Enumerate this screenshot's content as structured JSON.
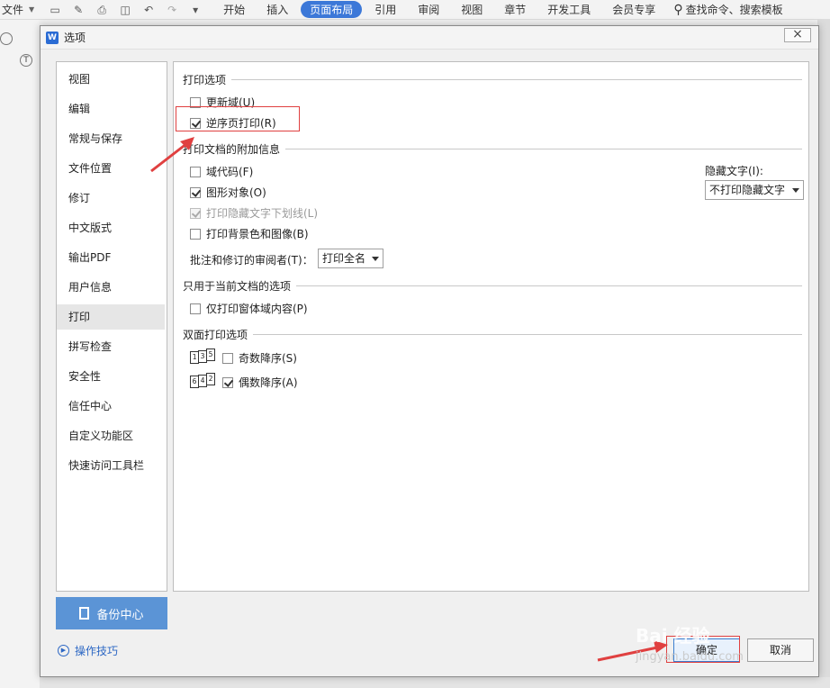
{
  "ribbon": {
    "file_label": "文件",
    "tabs": [
      "开始",
      "插入",
      "页面布局",
      "引用",
      "审阅",
      "视图",
      "章节",
      "开发工具",
      "会员专享"
    ],
    "active_tab": "页面布局",
    "search_text": "查找命令、搜索模板"
  },
  "dialog": {
    "title": "选项",
    "close_label": "×",
    "nav_items": [
      "视图",
      "编辑",
      "常规与保存",
      "文件位置",
      "修订",
      "中文版式",
      "输出PDF",
      "用户信息",
      "打印",
      "拼写检查",
      "安全性",
      "信任中心",
      "自定义功能区",
      "快速访问工具栏"
    ],
    "selected_nav": "打印",
    "backup_label": "备份中心",
    "tips_label": "操作技巧",
    "ok_label": "确定",
    "cancel_label": "取消"
  },
  "print_options": {
    "group_title": "打印选项",
    "update_fields": {
      "label": "更新域(U)",
      "checked": false
    },
    "reverse_print": {
      "label": "逆序页打印(R)",
      "checked": true
    }
  },
  "extra_info": {
    "group_title": "打印文档的附加信息",
    "field_codes": {
      "label": "域代码(F)",
      "checked": false
    },
    "graphics": {
      "label": "图形对象(O)",
      "checked": true
    },
    "hidden_underline": {
      "label": "打印隐藏文字下划线(L)",
      "checked": true,
      "disabled": true
    },
    "background": {
      "label": "打印背景色和图像(B)",
      "checked": false
    },
    "reviewer_label": "批注和修订的审阅者(T)：",
    "reviewer_value": "打印全名",
    "hidden_text_label": "隐藏文字(I):",
    "hidden_text_value": "不打印隐藏文字"
  },
  "current_doc": {
    "group_title": "只用于当前文档的选项",
    "form_only": {
      "label": "仅打印窗体域内容(P)",
      "checked": false
    }
  },
  "duplex": {
    "group_title": "双面打印选项",
    "odd": {
      "label": "奇数降序(S)",
      "checked": false,
      "pages": [
        "1",
        "3",
        "5"
      ]
    },
    "even": {
      "label": "偶数降序(A)",
      "checked": true,
      "pages": [
        "6",
        "4",
        "2"
      ]
    }
  },
  "watermark": {
    "brand": "Bai 经验",
    "sub": "jingyan.baidu.com"
  },
  "colors": {
    "accent": "#3c78d8",
    "highlight": "#e04040",
    "backup": "#5b94d6"
  }
}
